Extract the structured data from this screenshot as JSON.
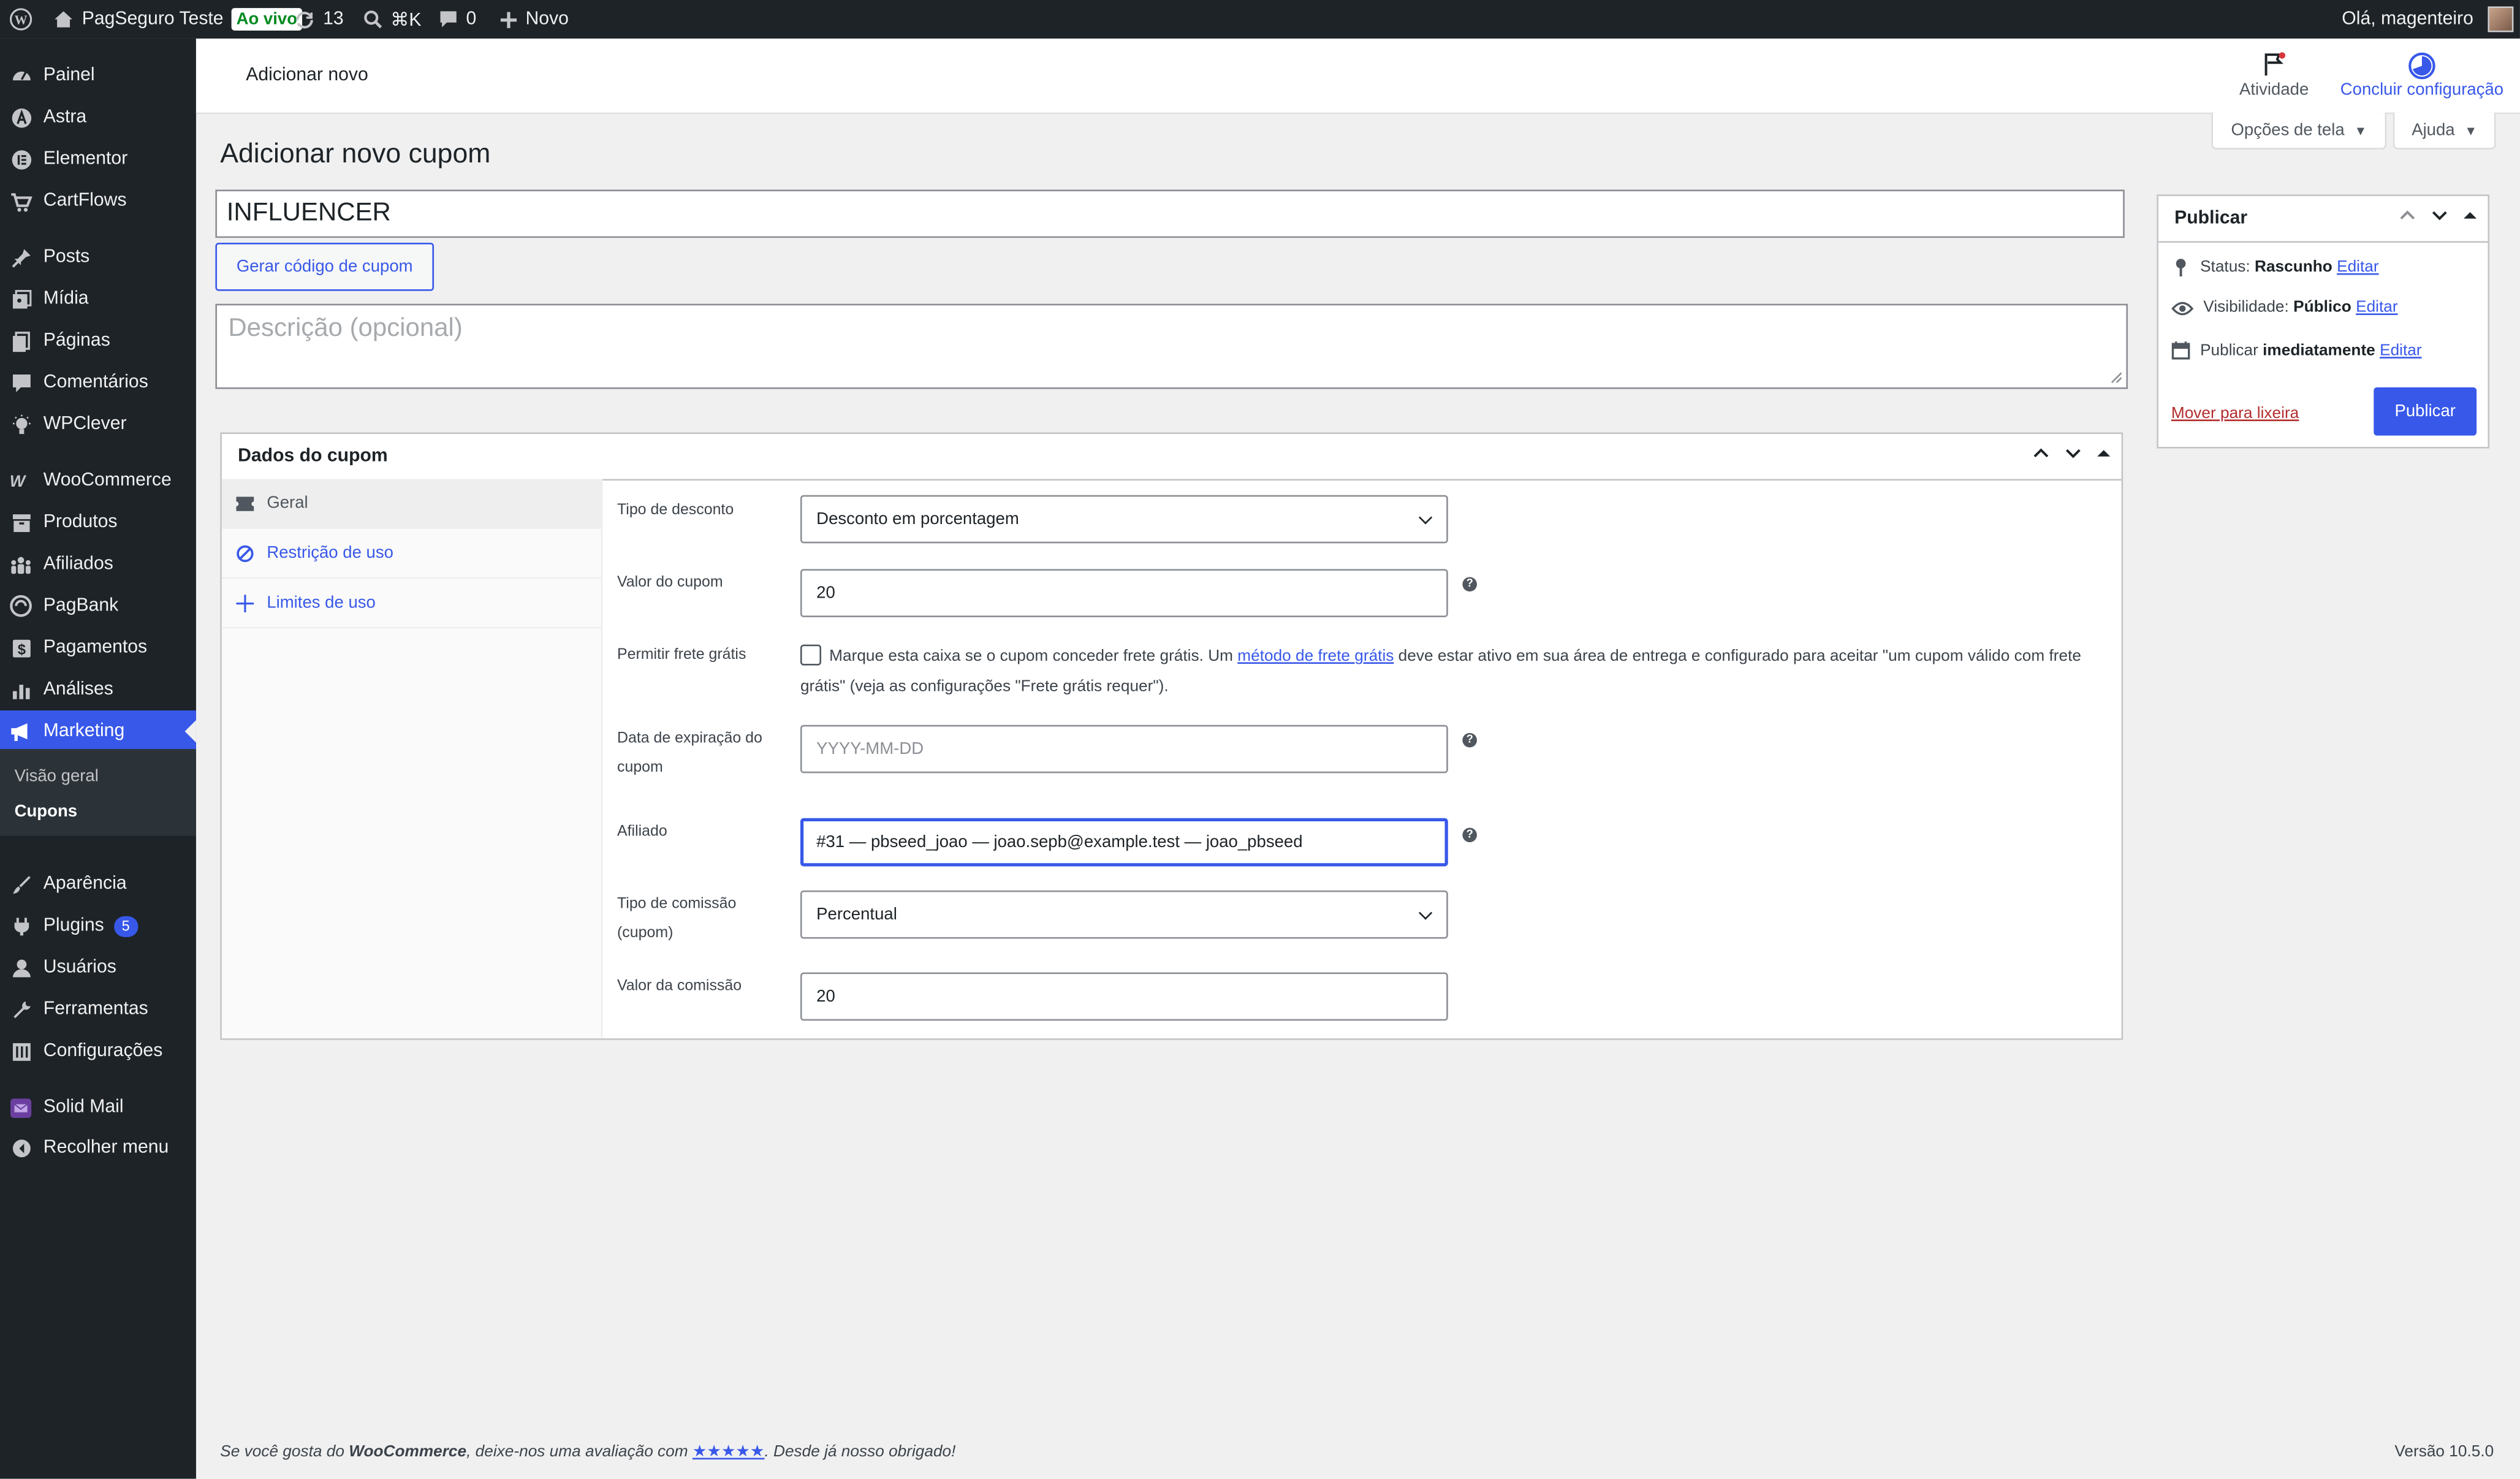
{
  "admin_bar": {
    "site_name": "PagSeguro Teste",
    "live_badge": "Ao vivo",
    "updates_count": "13",
    "search_shortcut": "⌘K",
    "comments_count": "0",
    "new_label": "Novo",
    "greeting": "Olá, magenteiro"
  },
  "sidebar": {
    "items": [
      {
        "label": "Painel",
        "icon": "dashboard-icon"
      },
      {
        "label": "Astra",
        "icon": "astra-icon"
      },
      {
        "label": "Elementor",
        "icon": "elementor-icon"
      },
      {
        "label": "CartFlows",
        "icon": "cartflows-icon"
      },
      {
        "label": "Posts",
        "icon": "pin-icon"
      },
      {
        "label": "Mídia",
        "icon": "media-icon"
      },
      {
        "label": "Páginas",
        "icon": "pages-icon"
      },
      {
        "label": "Comentários",
        "icon": "comments-icon"
      },
      {
        "label": "WPClever",
        "icon": "lightbulb-icon"
      },
      {
        "label": "WooCommerce",
        "icon": "woocommerce-icon"
      },
      {
        "label": "Produtos",
        "icon": "archive-icon"
      },
      {
        "label": "Afiliados",
        "icon": "groups-icon"
      },
      {
        "label": "PagBank",
        "icon": "pagbank-icon"
      },
      {
        "label": "Pagamentos",
        "icon": "payments-icon"
      },
      {
        "label": "Análises",
        "icon": "chart-icon"
      },
      {
        "label": "Marketing",
        "icon": "megaphone-icon"
      },
      {
        "label": "Aparência",
        "icon": "brush-icon"
      },
      {
        "label": "Plugins",
        "icon": "plugin-icon",
        "badge": "5"
      },
      {
        "label": "Usuários",
        "icon": "user-icon"
      },
      {
        "label": "Ferramentas",
        "icon": "wrench-icon"
      },
      {
        "label": "Configurações",
        "icon": "settings-icon"
      },
      {
        "label": "Solid Mail",
        "icon": "mail-icon"
      },
      {
        "label": "Recolher menu",
        "icon": "collapse-icon"
      }
    ],
    "submenu": [
      "Visão geral",
      "Cupons"
    ]
  },
  "header": {
    "title": "Adicionar novo",
    "activity_label": "Atividade",
    "setup_label": "Concluir configuração",
    "screen_options": "Opções de tela",
    "help": "Ajuda"
  },
  "page": {
    "title": "Adicionar novo cupom",
    "coupon_code": "INFLUENCER",
    "generate_button": "Gerar código de cupom",
    "description_placeholder": "Descrição (opcional)"
  },
  "coupon_data": {
    "title": "Dados do cupom",
    "tabs": [
      "Geral",
      "Restrição de uso",
      "Limites de uso"
    ],
    "fields": {
      "discount_type_label": "Tipo de desconto",
      "discount_type_value": "Desconto em porcentagem",
      "amount_label": "Valor do cupom",
      "amount_value": "20",
      "free_shipping_label": "Permitir frete grátis",
      "free_shipping_text_1": "Marque esta caixa se o cupom conceder frete grátis. Um ",
      "free_shipping_link": "método de frete grátis",
      "free_shipping_text_2": " deve estar ativo em sua área de entrega e configurado para aceitar \"um cupom válido com frete grátis\" (veja as configurações \"Frete grátis requer\").",
      "expiry_label": "Data de expiração do cupom",
      "expiry_placeholder": "YYYY-MM-DD",
      "affiliate_label": "Afiliado",
      "affiliate_value": "#31 — pbseed_joao — joao.sepb@example.test — joao_pbseed",
      "commission_type_label": "Tipo de comissão (cupom)",
      "commission_type_value": "Percentual",
      "commission_value_label": "Valor da comissão",
      "commission_value": "20"
    }
  },
  "publish": {
    "title": "Publicar",
    "status_label": "Status:",
    "status_value": "Rascunho",
    "visibility_label": "Visibilidade:",
    "visibility_value": "Público",
    "publish_label": "Publicar",
    "publish_value": "imediatamente",
    "edit": "Editar",
    "trash": "Mover para lixeira",
    "button": "Publicar"
  },
  "footer": {
    "left_1": "Se você gosta do ",
    "left_brand": "WooCommerce",
    "left_2": ", deixe-nos uma avaliação com ",
    "left_stars": "★★★★★",
    "left_3": ". Desde já nosso obrigado!",
    "version": "Versão 10.5.0"
  },
  "colors": {
    "accent": "#3858e9",
    "sidebar_bg": "#1d2327",
    "danger": "#b32d2e"
  }
}
